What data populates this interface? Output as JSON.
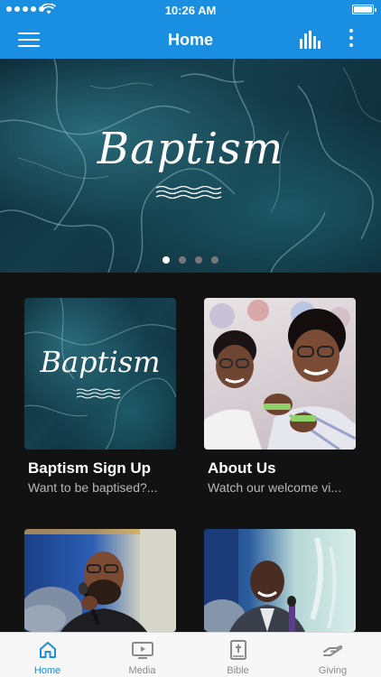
{
  "status_bar": {
    "time": "10:26 AM"
  },
  "header": {
    "title": "Home"
  },
  "hero": {
    "title": "Baptism",
    "slides": 4,
    "active_slide": 1
  },
  "cards": [
    {
      "title": "Baptism Sign Up",
      "subtitle": "Want to be baptised?...",
      "image": "Baptism"
    },
    {
      "title": "About Us",
      "subtitle": "Watch our welcome vi..."
    },
    {
      "title": "",
      "subtitle": ""
    },
    {
      "title": "",
      "subtitle": ""
    }
  ],
  "tabs": [
    {
      "label": "Home",
      "icon": "home-icon",
      "active": true
    },
    {
      "label": "Media",
      "icon": "media-icon",
      "active": false
    },
    {
      "label": "Bible",
      "icon": "bible-icon",
      "active": false
    },
    {
      "label": "Giving",
      "icon": "giving-icon",
      "active": false
    }
  ],
  "colors": {
    "accent": "#1a8ee0",
    "background": "#121212",
    "tab_inactive": "#8a8a8a"
  }
}
